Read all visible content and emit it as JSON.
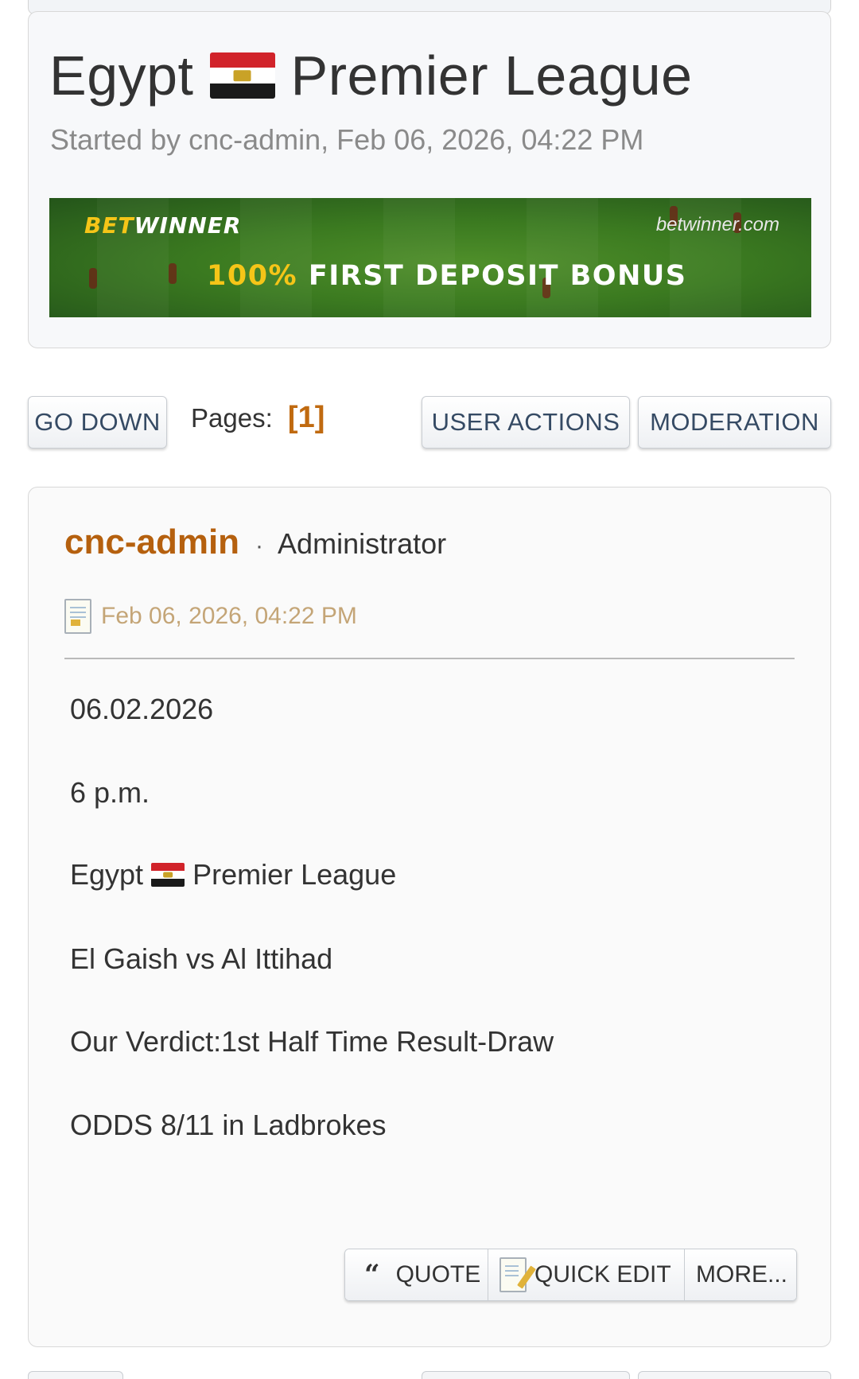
{
  "topic": {
    "title_before_flag": "Egypt",
    "title_after_flag": "Premier League",
    "flag_icon": "egypt-flag-icon",
    "started_by": "Started by cnc-admin, Feb 06, 2026, 04:22 PM"
  },
  "banner": {
    "logo_bet": "BET",
    "logo_winner": "WINNER",
    "site": "betwinner.com",
    "headline_percent": "100%",
    "headline_rest": "FIRST DEPOSIT BONUS"
  },
  "toolbar": {
    "go_down": "GO DOWN",
    "pages_label": "Pages:",
    "current_page": "[1]",
    "user_actions": "USER ACTIONS",
    "moderation": "MODERATION"
  },
  "post": {
    "author": "cnc-admin",
    "separator": "·",
    "role": "Administrator",
    "date": "Feb 06, 2026, 04:22 PM",
    "lines": {
      "date": "06.02.2026",
      "time": "6 p.m.",
      "league_before_flag": "Egypt",
      "league_after_flag": "Premier League",
      "match": "El Gaish vs Al Ittihad",
      "verdict": "Our Verdict:1st Half Time Result-Draw",
      "odds": "ODDS 8/11 in Ladbrokes"
    },
    "actions": {
      "quote_icon": "“",
      "quote": "QUOTE",
      "quick_edit": "QUICK EDIT",
      "more": "MORE..."
    }
  },
  "colors": {
    "author": "#b5600e",
    "current_page": "#c06a10",
    "date": "#c4a577",
    "button_text": "#354a64"
  }
}
